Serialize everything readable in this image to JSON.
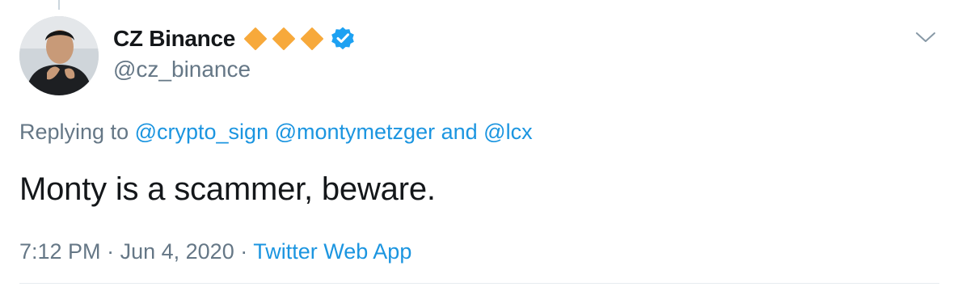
{
  "tweet": {
    "author": {
      "display_name": "CZ Binance",
      "handle": "@cz_binance",
      "badge_icons": [
        "orange-diamond-icon",
        "orange-diamond-icon",
        "orange-diamond-icon",
        "verified-badge-icon"
      ]
    },
    "replying_to": {
      "prefix": "Replying to",
      "mentions": [
        "@crypto_sign",
        "@montymetzger",
        "@lcx"
      ],
      "connector": "and"
    },
    "text": "Monty is a scammer, beware.",
    "time": "7:12 PM",
    "date": "Jun 4, 2020",
    "separator": "·",
    "source": "Twitter Web App"
  },
  "colors": {
    "text_primary": "#14171a",
    "text_secondary": "#657786",
    "link": "#1b95e0",
    "diamond": "#f7a93b",
    "verified": "#1da1f2"
  }
}
